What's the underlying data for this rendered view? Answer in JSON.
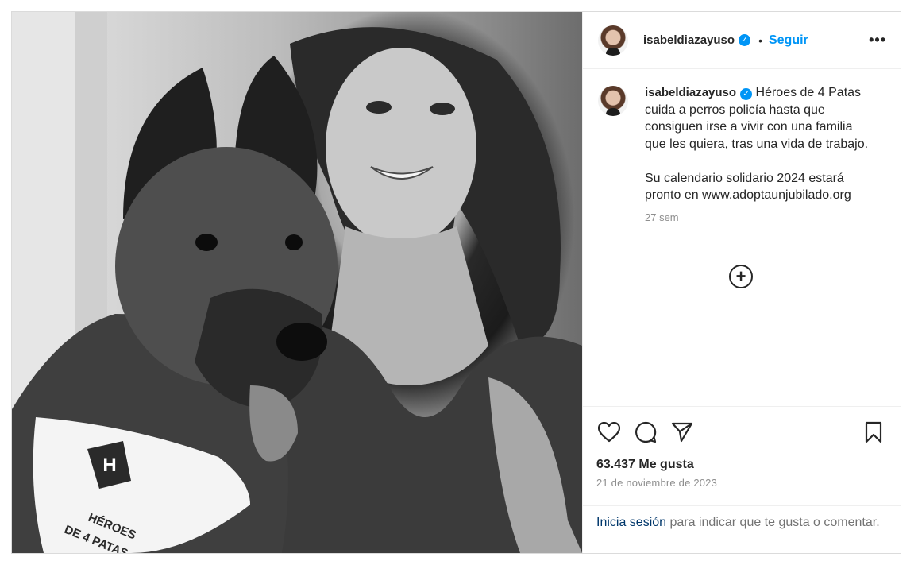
{
  "post": {
    "username": "isabeldiazayuso",
    "verified_symbol": "✓",
    "separator": "•",
    "follow_label": "Seguir",
    "more_label": "•••",
    "caption_text": " Héroes de 4 Patas cuida a perros policía hasta que consiguen irse a vivir con una familia que les quiera, tras una vida de trabajo.\n\nSu calendario solidario 2024 estará pronto en www.adoptaunjubilado.org",
    "caption_time": "27 sem",
    "load_more_symbol": "+",
    "likes": "63.437 Me gusta",
    "date": "21 de noviembre de 2023",
    "login_link": "Inicia sesión",
    "login_text": " para indicar que te gusta o comentar.",
    "image_scarf_line1": "HÉROES",
    "image_scarf_line2": "DE 4 PATAS",
    "image_scarf_logo": "H"
  },
  "icons": {
    "like": "heart-icon",
    "comment": "comment-icon",
    "share": "send-icon",
    "save": "bookmark-icon"
  },
  "colors": {
    "link_blue": "#0095f6",
    "login_blue": "#00376b",
    "muted": "#8e8e8e",
    "text": "#262626"
  }
}
